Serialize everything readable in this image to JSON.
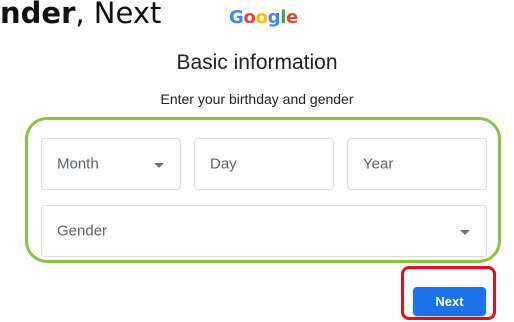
{
  "caption": {
    "bold_part": "nder",
    "rest": ", Next"
  },
  "logo": {
    "letters": [
      "G",
      "o",
      "o",
      "g",
      "l",
      "e"
    ],
    "colors": [
      "#4285F4",
      "#EA4335",
      "#FBBC05",
      "#4285F4",
      "#34A853",
      "#EA4335"
    ]
  },
  "heading": "Basic information",
  "subheading": "Enter your birthday and gender",
  "fields": {
    "month": {
      "label": "Month",
      "icon": "chevron-down-icon"
    },
    "day": {
      "label": "Day"
    },
    "year": {
      "label": "Year"
    },
    "gender": {
      "label": "Gender",
      "icon": "chevron-down-icon"
    }
  },
  "next_button": {
    "label": "Next"
  },
  "colors": {
    "highlight_green": "#8bc34a",
    "highlight_red": "#e10e1e",
    "primary_blue": "#1a73e8"
  }
}
